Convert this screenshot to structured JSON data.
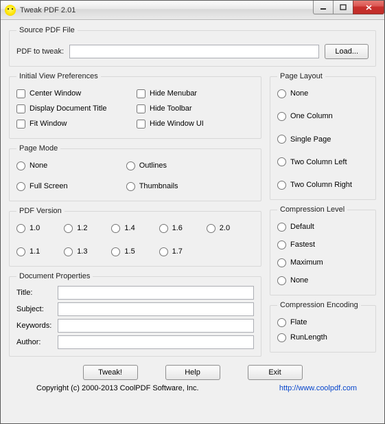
{
  "window": {
    "title": "Tweak PDF 2.01"
  },
  "source": {
    "legend": "Source PDF File",
    "label": "PDF to tweak:",
    "value": "",
    "load": "Load..."
  },
  "ivp": {
    "legend": "Initial View Preferences",
    "items": [
      {
        "label": "Center Window"
      },
      {
        "label": "Hide Menubar"
      },
      {
        "label": "Display Document Title"
      },
      {
        "label": "Hide Toolbar"
      },
      {
        "label": "Fit Window"
      },
      {
        "label": "Hide Window UI"
      }
    ]
  },
  "pagemode": {
    "legend": "Page Mode",
    "items": [
      {
        "label": "None"
      },
      {
        "label": "Outlines"
      },
      {
        "label": "Full Screen"
      },
      {
        "label": "Thumbnails"
      }
    ]
  },
  "pdfver": {
    "legend": "PDF Version",
    "items": [
      "1.0",
      "1.2",
      "1.4",
      "1.6",
      "2.0",
      "1.1",
      "1.3",
      "1.5",
      "1.7"
    ]
  },
  "docprops": {
    "legend": "Document Properties",
    "title_label": "Title:",
    "subject_label": "Subject:",
    "keywords_label": "Keywords:",
    "author_label": "Author:",
    "title": "",
    "subject": "",
    "keywords": "",
    "author": ""
  },
  "pagelayout": {
    "legend": "Page Layout",
    "items": [
      "None",
      "One Column",
      "Single Page",
      "Two Column Left",
      "Two Column Right"
    ]
  },
  "complevel": {
    "legend": "Compression Level",
    "items": [
      "Default",
      "Fastest",
      "Maximum",
      "None"
    ]
  },
  "compenc": {
    "legend": "Compression Encoding",
    "items": [
      "Flate",
      "RunLength"
    ]
  },
  "buttons": {
    "tweak": "Tweak!",
    "help": "Help",
    "exit": "Exit"
  },
  "footer": {
    "copyright": "Copyright (c) 2000-2013 CoolPDF Software, Inc.",
    "url": "http://www.coolpdf.com"
  }
}
